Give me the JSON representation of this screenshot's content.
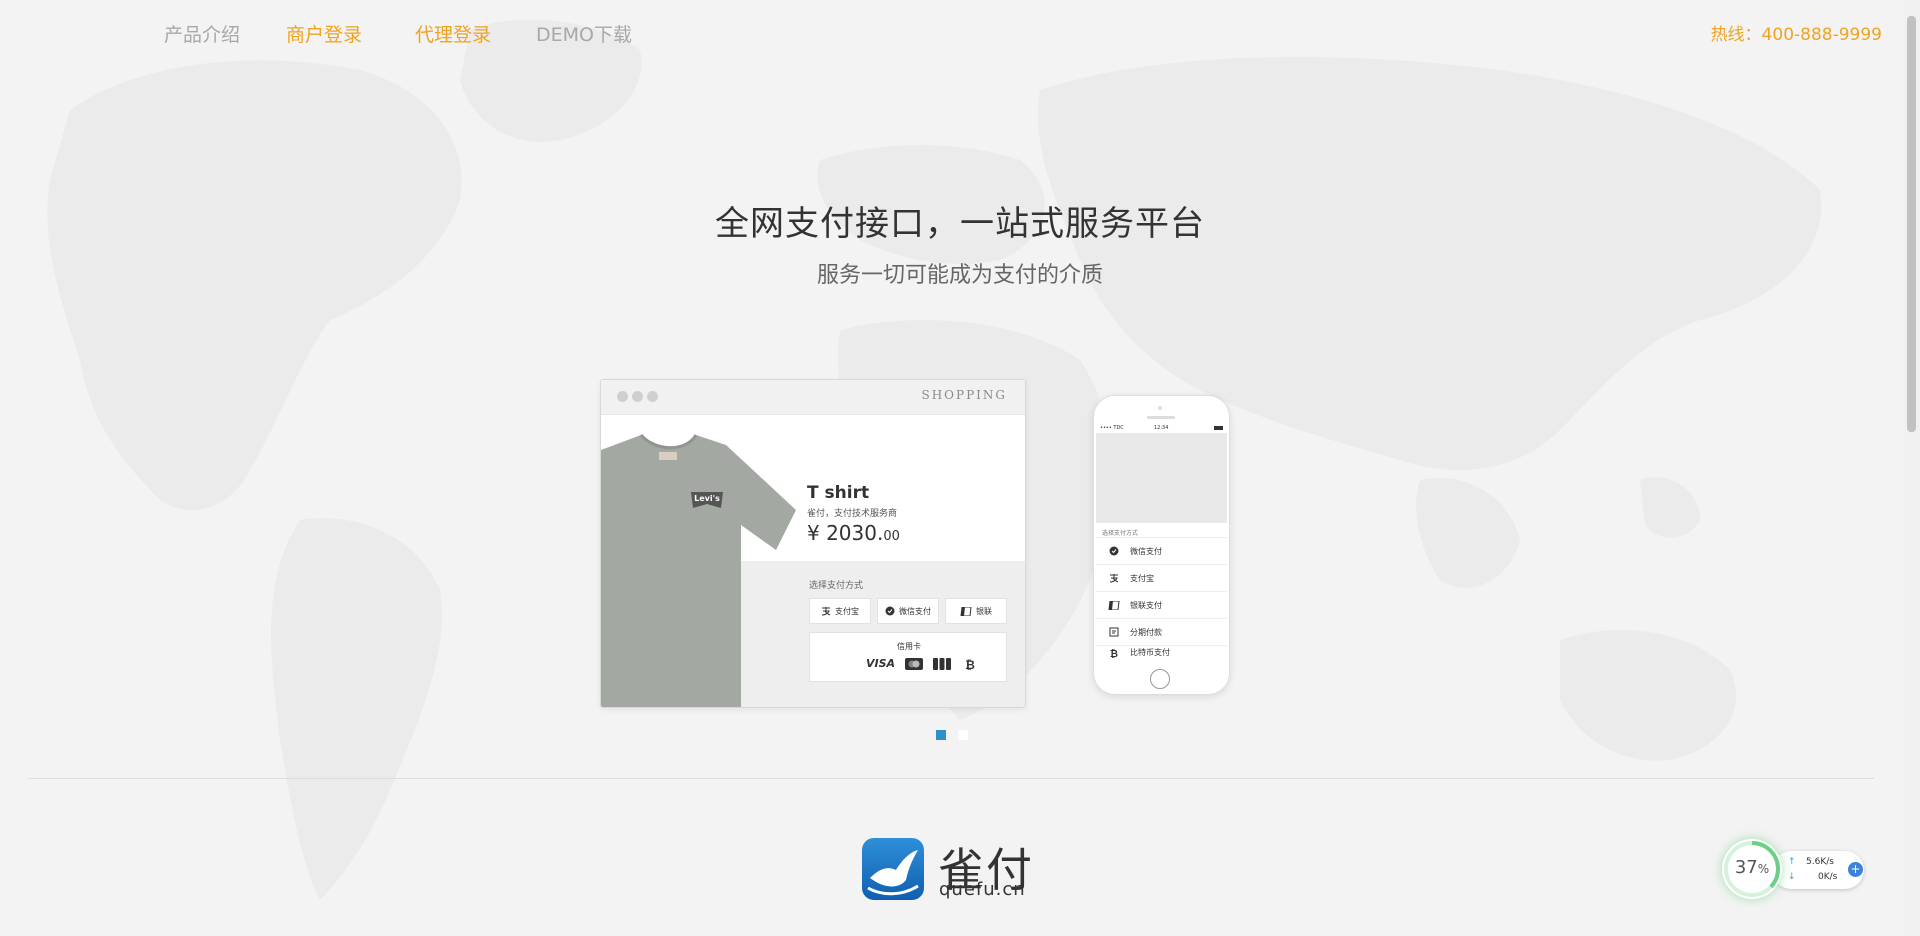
{
  "nav": {
    "links": [
      "产品介绍",
      "商户登录",
      "代理登录",
      "DEMO下载"
    ],
    "hotline": "热线：400-888-9999"
  },
  "hero": {
    "title": "全网支付接口，一站式服务平台",
    "subtitle": "服务一切可能成为支付的介质"
  },
  "browser_mock": {
    "header": "SHOPPING",
    "tshirt_brand": "Levi's",
    "product_name": "T shirt",
    "product_desc": "雀付，支付技术服务商",
    "price_main": "¥ 2030.",
    "price_cents": "00",
    "pay_label": "选择支付方式",
    "pay_buttons": [
      "支付宝",
      "微信支付",
      "银联"
    ],
    "card_label": "信用卡",
    "card_visa": "VISA"
  },
  "phone_mock": {
    "carrier": "•••• TDC",
    "time": "12:34",
    "label": "选择支付方式",
    "options": [
      "微信支付",
      "支付宝",
      "银联支付",
      "分期付款",
      "比特币支付"
    ]
  },
  "slider": {
    "count": 2,
    "active_index": 0
  },
  "brand": {
    "name": "雀付",
    "domain": "quefu.cn"
  },
  "widget": {
    "percent": "37",
    "percent_unit": "%",
    "upload": "5.6K/s",
    "download": "0K/s",
    "plus": "+"
  },
  "colors": {
    "accent": "#f0a322",
    "muted": "#a8a8a8",
    "slider_active": "#2f8fc7",
    "brand_blue": "#1a6fc2"
  },
  "icons": [
    "alipay-icon",
    "wechat-icon",
    "unionpay-icon",
    "installment-icon",
    "bitcoin-icon",
    "mastercard-icon",
    "jcb-icon",
    "plus-icon",
    "up-arrow-icon",
    "down-arrow-icon"
  ]
}
